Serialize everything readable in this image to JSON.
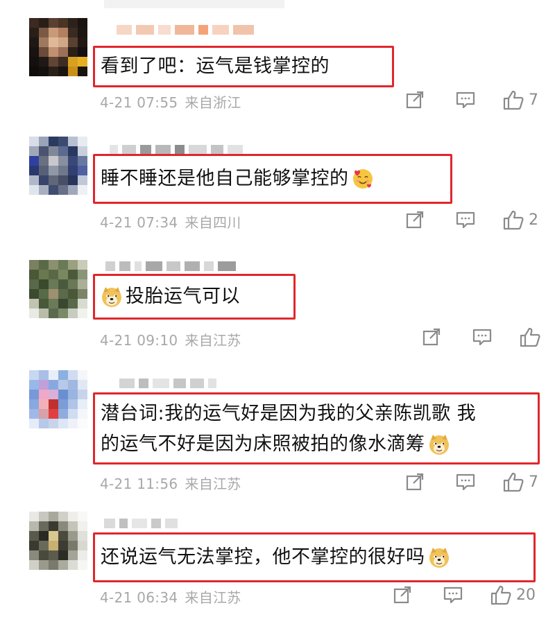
{
  "comments": [
    {
      "text": "看到了吧：运气是钱掌控的",
      "time": "4-21 07:55",
      "location": "来自浙江",
      "likes": "7"
    },
    {
      "text": "睡不睡还是他自己能够掌控的",
      "emoji": "smiling-hearts-emoji",
      "time": "4-21 07:34",
      "location": "来自四川",
      "likes": "2"
    },
    {
      "text": "投胎运气可以",
      "emoji_before": "doge-emoji",
      "time": "4-21 09:10",
      "location": "来自江苏",
      "likes": ""
    },
    {
      "text_line1": "潜台词:我的运气好是因为我的父亲陈凯歌 我",
      "text_line2": "的运气不好是因为床照被拍的像水滴筹",
      "emoji": "doge-emoji",
      "time": "4-21 11:56",
      "location": "来自江苏",
      "likes": "7"
    },
    {
      "text": "还说运气无法掌控，他不掌控的很好吗",
      "emoji": "doge-emoji",
      "time": "4-21 06:34",
      "location": "来自江苏",
      "likes": "20"
    }
  ],
  "icons": {
    "share": "share-icon",
    "comment": "comment-icon",
    "like": "thumbs-up-icon"
  },
  "colors": {
    "highlight_border": "#e0262b",
    "meta_text": "#a8a8a8",
    "icon": "#8a8a8a"
  }
}
